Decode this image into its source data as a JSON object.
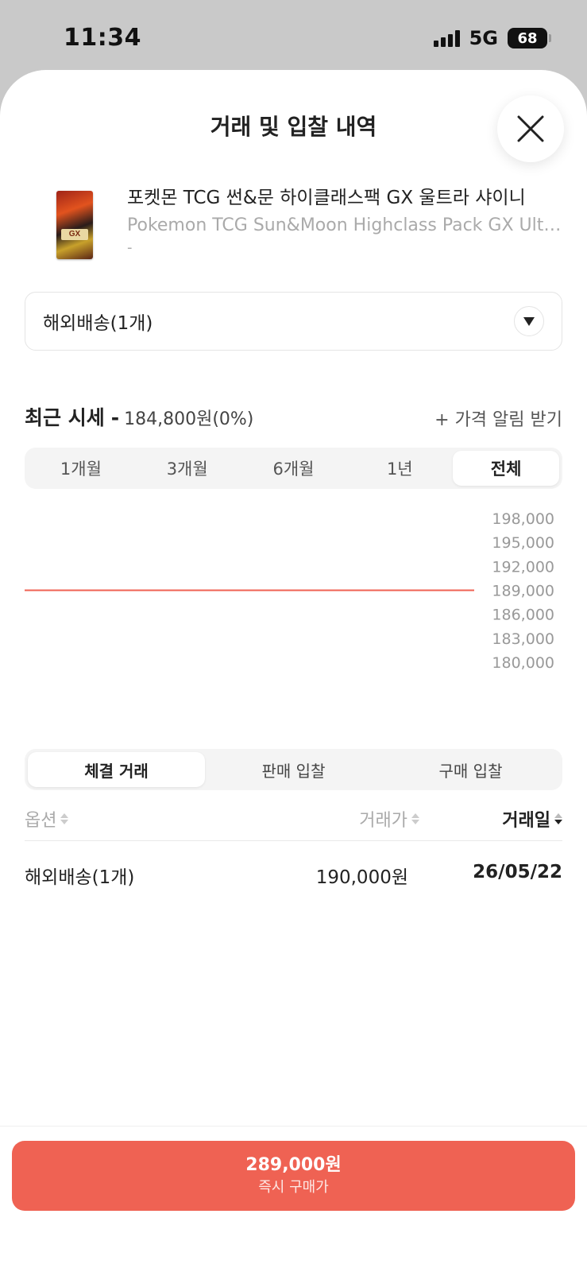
{
  "status_bar": {
    "time": "11:34",
    "network": "5G",
    "battery": "68"
  },
  "sheet": {
    "title": "거래 및 입찰 내역"
  },
  "product": {
    "name_ko": "포켓몬 TCG 썬&문 하이클래스팩 GX 울트라 샤이니",
    "name_en": "Pokemon TCG Sun&Moon Highclass Pack GX Ultra Shiny",
    "sub": "-",
    "pack_badge": "GX"
  },
  "option": {
    "selected": "해외배송(1개)"
  },
  "recent": {
    "title": "최근 시세",
    "separator": "-",
    "price": "184,800원(0%)",
    "alert_link": "+ 가격 알림 받기"
  },
  "period_tabs": [
    "1개월",
    "3개월",
    "6개월",
    "1년",
    "전체"
  ],
  "period_active": 4,
  "chart_data": {
    "type": "line",
    "series": [
      {
        "values": [
          189000,
          189000
        ]
      }
    ],
    "ylim": [
      180000,
      198000
    ],
    "y_ticks": [
      "198,000",
      "195,000",
      "192,000",
      "189,000",
      "186,000",
      "183,000",
      "180,000"
    ],
    "line_color": "#ef6253",
    "grid": false
  },
  "trade_tabs": [
    "체결 거래",
    "판매 입찰",
    "구매 입찰"
  ],
  "trade_active": 0,
  "table": {
    "headers": {
      "option": "옵션",
      "price": "거래가",
      "date": "거래일"
    },
    "rows": [
      {
        "option": "해외배송(1개)",
        "price": "190,000원",
        "date": "26/05/22"
      }
    ]
  },
  "buy_button": {
    "price": "289,000원",
    "label": "즉시 구매가"
  },
  "colors": {
    "accent": "#ef6253"
  }
}
